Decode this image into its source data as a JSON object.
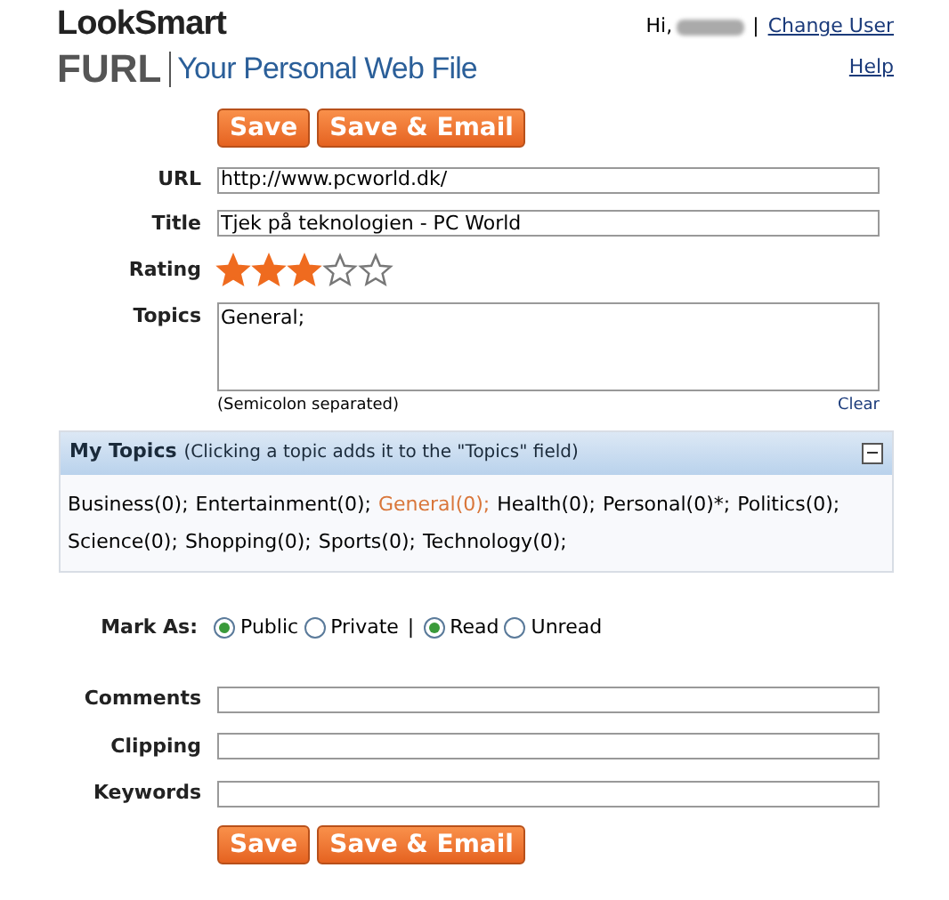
{
  "header": {
    "brand": "LookSmart",
    "product": "FURL",
    "tagline": "Your Personal Web File",
    "greeting": "Hi,",
    "separator": "|",
    "links": [
      "Change User",
      "Help"
    ]
  },
  "top_buttons": [
    "Save",
    "Save & Email"
  ],
  "fields": [
    {
      "label": "URL",
      "value": "http://www.pcworld.dk/"
    },
    {
      "label": "Title",
      "value": "Tjek på teknologien - PC World"
    }
  ],
  "rating": {
    "label": "Rating",
    "stars": 3
  },
  "topics": {
    "label": "Topics",
    "value": "General;",
    "hint": "(Semicolon separated)",
    "clear": "Clear"
  },
  "my_topics": {
    "title": "My Topics",
    "subtitle": "(Clicking a topic adds it to the \"Topics\" field)",
    "expanded": true,
    "items": [
      {
        "label": "Business(0);",
        "selected": false
      },
      {
        "label": "Entertainment(0);",
        "selected": false
      },
      {
        "label": "General(0);",
        "selected": true
      },
      {
        "label": "Health(0);",
        "selected": false
      },
      {
        "label": "Personal(0)*;",
        "selected": false
      },
      {
        "label": "Politics(0);",
        "selected": false
      },
      {
        "label": "Science(0);",
        "selected": false
      },
      {
        "label": "Shopping(0);",
        "selected": false
      },
      {
        "label": "Sports(0);",
        "selected": false
      },
      {
        "label": "Technology(0);",
        "selected": false
      }
    ]
  },
  "mark_as": {
    "label": "Mark As:",
    "separator": "|",
    "groups": [
      [
        {
          "label": "Public",
          "selected": true
        },
        {
          "label": "Private",
          "selected": false
        }
      ],
      [
        {
          "label": "Read",
          "selected": true
        },
        {
          "label": "Unread",
          "selected": false
        }
      ]
    ]
  },
  "extra_fields": [
    {
      "label": "Comments"
    },
    {
      "label": "Clipping"
    },
    {
      "label": "Keywords"
    }
  ],
  "bottom_buttons": [
    "Save",
    "Save & Email"
  ]
}
